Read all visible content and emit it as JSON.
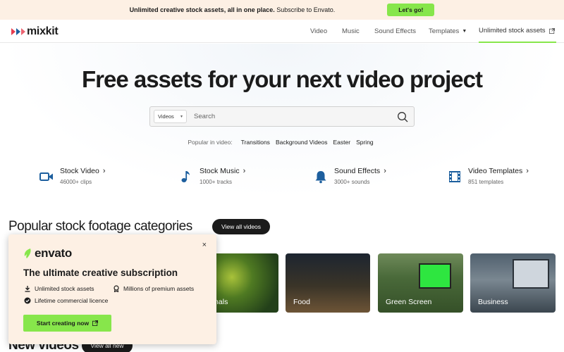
{
  "promo": {
    "text_bold": "Unlimited creative stock assets, all in one place.",
    "text_regular": "Subscribe to Envato.",
    "button": "Let's go!"
  },
  "header": {
    "logo": "mixkit",
    "nav": [
      "Video",
      "Music",
      "Sound Effects",
      "Templates",
      "Unlimited stock assets"
    ]
  },
  "hero": {
    "title": "Free assets for your next video project",
    "search": {
      "select": "Videos",
      "placeholder": "Search"
    },
    "popular_label": "Popular in video:",
    "popular_tags": [
      "Transitions",
      "Background Videos",
      "Easter",
      "Spring"
    ]
  },
  "categories": [
    {
      "title": "Stock Video",
      "sub": "46000+ clips",
      "icon": "video-camera-icon"
    },
    {
      "title": "Stock Music",
      "sub": "1000+ tracks",
      "icon": "music-note-icon"
    },
    {
      "title": "Sound Effects",
      "sub": "3000+ sounds",
      "icon": "bell-icon"
    },
    {
      "title": "Video Templates",
      "sub": "851 templates",
      "icon": "film-strip-icon"
    }
  ],
  "popular_section": {
    "title": "Popular stock footage categories",
    "view_all": "View all videos",
    "tiles": [
      "Animals",
      "Food",
      "Green Screen",
      "Business"
    ]
  },
  "new_section": {
    "title": "New videos",
    "view_all": "View all new"
  },
  "popup": {
    "close": "×",
    "brand": "envato",
    "heading": "The ultimate creative subscription",
    "features": [
      "Unlimited stock assets",
      "Millions of premium assets",
      "Lifetime commercial licence"
    ],
    "button": "Start creating now"
  },
  "colors": {
    "accent_green": "#87e64b",
    "promo_bg": "#fdf0e4",
    "icon_blue": "#1d5f9e",
    "logo_red": "#e73d4f"
  }
}
